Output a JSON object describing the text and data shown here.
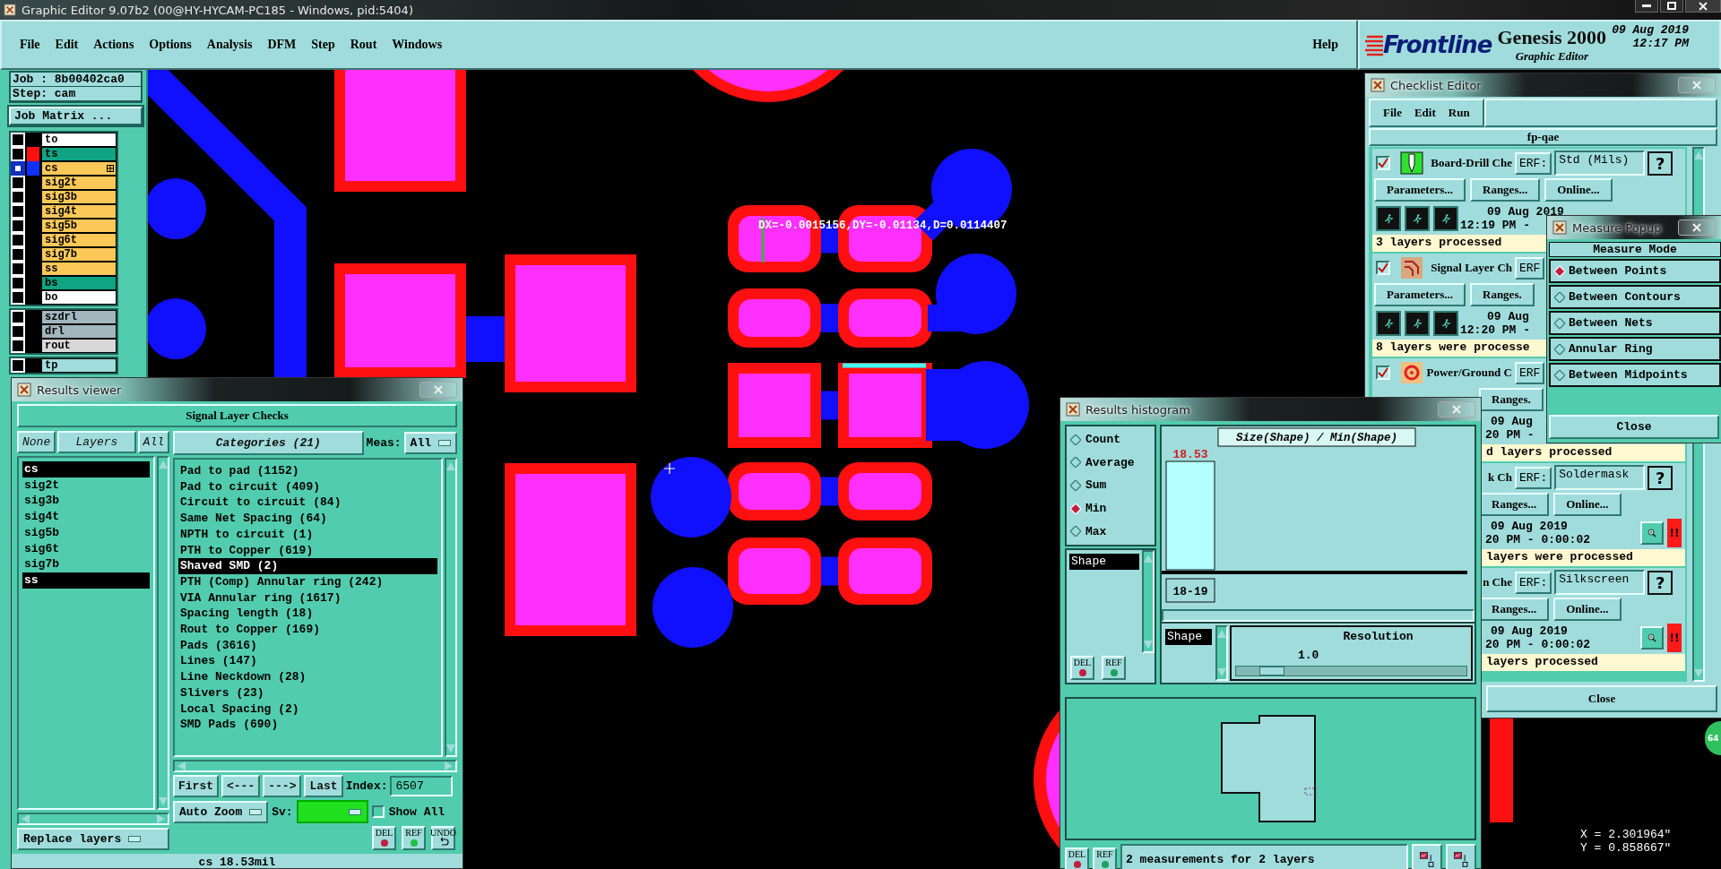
{
  "window": {
    "title": "Graphic Editor 9.07b2 (00@HY-HYCAM-PC185 - Windows, pid:5404)"
  },
  "menu": {
    "items": [
      "File",
      "Edit",
      "Actions",
      "Options",
      "Analysis",
      "DFM",
      "Step",
      "Rout",
      "Windows"
    ],
    "help": "Help"
  },
  "brand": {
    "logo": "Frontline",
    "product": "Genesis 2000",
    "subtitle": "Graphic Editor",
    "date": "09 Aug 2019",
    "time": "12:17 PM"
  },
  "job_panel": {
    "job": "Job : 8b00402ca0",
    "step": "Step: cam",
    "matrix_button": "Job Matrix ..."
  },
  "layer_groups": [
    {
      "layers": [
        {
          "name": "to",
          "kind": "silk",
          "selected": false
        },
        {
          "name": "ts",
          "kind": "mask",
          "color": "#ff1010",
          "selected": false
        },
        {
          "name": "cs",
          "kind": "signal",
          "color": "#1030ff",
          "selected": true
        },
        {
          "name": "sig2t",
          "kind": "signal",
          "selected": false
        },
        {
          "name": "sig3b",
          "kind": "signal",
          "selected": false
        },
        {
          "name": "sig4t",
          "kind": "signal",
          "selected": false
        },
        {
          "name": "sig5b",
          "kind": "signal",
          "selected": false
        },
        {
          "name": "sig6t",
          "kind": "signal",
          "selected": false
        },
        {
          "name": "sig7b",
          "kind": "signal",
          "selected": false
        },
        {
          "name": "ss",
          "kind": "signal",
          "selected": false
        },
        {
          "name": "bs",
          "kind": "mask",
          "selected": false
        },
        {
          "name": "bo",
          "kind": "silk",
          "selected": false
        }
      ]
    },
    {
      "layers": [
        {
          "name": "szdrl",
          "kind": "drill",
          "selected": false
        },
        {
          "name": "drl",
          "kind": "drill",
          "selected": false
        },
        {
          "name": "rout",
          "kind": "rout",
          "selected": false
        }
      ]
    },
    {
      "layers": [
        {
          "name": "tp",
          "kind": "paste",
          "selected": false
        }
      ]
    }
  ],
  "canvas": {
    "measurement": "DX=-0.0015156,DY=-0.01134,D=0.0114407",
    "x_readout": "X = 2.301964\"",
    "y_readout": "Y = 0.858667\"",
    "badge": "64"
  },
  "results_viewer": {
    "title": "Results viewer",
    "heading": "Signal Layer Checks",
    "layer_buttons": [
      "None",
      "Layers",
      "All"
    ],
    "layers": [
      {
        "name": "cs",
        "selected": true
      },
      {
        "name": "sig2t",
        "selected": false
      },
      {
        "name": "sig3b",
        "selected": false
      },
      {
        "name": "sig4t",
        "selected": false
      },
      {
        "name": "sig5b",
        "selected": false
      },
      {
        "name": "sig6t",
        "selected": false
      },
      {
        "name": "sig7b",
        "selected": false
      },
      {
        "name": "ss",
        "selected": true
      }
    ],
    "categories_button": "Categories (21)",
    "meas_label": "Meas:",
    "meas_value": "All",
    "categories": [
      {
        "label": "Pad to pad (1152)",
        "selected": false
      },
      {
        "label": "Pad to circuit (409)",
        "selected": false
      },
      {
        "label": "Circuit to circuit (84)",
        "selected": false
      },
      {
        "label": "Same Net Spacing (64)",
        "selected": false
      },
      {
        "label": "NPTH to circuit (1)",
        "selected": false
      },
      {
        "label": "PTH to Copper (619)",
        "selected": false
      },
      {
        "label": "Shaved SMD (2)",
        "selected": true
      },
      {
        "label": "PTH (Comp) Annular ring (242)",
        "selected": false
      },
      {
        "label": "VIA Annular ring (1617)",
        "selected": false
      },
      {
        "label": "Spacing length (18)",
        "selected": false
      },
      {
        "label": "Rout to Copper (169)",
        "selected": false
      },
      {
        "label": "Pads (3616)",
        "selected": false
      },
      {
        "label": "Lines (147)",
        "selected": false
      },
      {
        "label": "Line Neckdown (28)",
        "selected": false
      },
      {
        "label": "Slivers (23)",
        "selected": false
      },
      {
        "label": "Local Spacing (2)",
        "selected": false
      },
      {
        "label": "SMD Pads (690)",
        "selected": false
      }
    ],
    "nav_buttons": [
      "First",
      "<---",
      "--->",
      "Last"
    ],
    "index_label": "Index:",
    "index_value": "6507",
    "zoom_mode": "Auto Zoom",
    "sv_label": "Sv:",
    "show_all": {
      "label": "Show All",
      "checked": false
    },
    "replace_mode": "Replace layers",
    "tool_buttons": [
      {
        "label": "DEL",
        "kind": "dot",
        "color": "#c02040"
      },
      {
        "label": "REF",
        "kind": "dot",
        "color": "#20c040"
      },
      {
        "label": "UNDO",
        "kind": "undo"
      }
    ],
    "status": "cs 18.53mil"
  },
  "checklist_editor": {
    "title": "Checklist Editor",
    "menu": [
      "File",
      "Edit",
      "Run"
    ],
    "name": "fp-qae",
    "checks": [
      {
        "checked": true,
        "name": "Board-Drill Che",
        "erf": "ERF:",
        "erf_value": "Std (Mils)",
        "help": "?",
        "buttons": [
          "Parameters...",
          "Ranges...",
          "Online..."
        ],
        "covered": false,
        "date": "09 Aug 2019",
        "time": "12:19 PM -",
        "status": "3 layers processed"
      },
      {
        "checked": true,
        "name": "Signal Layer Ch",
        "erf": "ERF",
        "buttons": [
          "Parameters...",
          "Ranges."
        ],
        "covered": false,
        "date": "09 Aug",
        "time": "12:20 PM -",
        "status": "8 layers were processe"
      },
      {
        "checked": true,
        "name": "Power/Ground C",
        "erf": "ERF",
        "buttons": [
          "Ranges."
        ],
        "covered": true,
        "date": "09 Aug",
        "time": "20 PM -",
        "status": "d layers processed"
      },
      {
        "name": "k Ch",
        "erf": "ERF:",
        "erf_value": "Soldermask",
        "help": "?",
        "buttons": [
          "Ranges...",
          "Online..."
        ],
        "covered": true,
        "date": "09 Aug 2019",
        "time": "20 PM - 0:00:02",
        "alert": "!!",
        "status": "layers were processed"
      },
      {
        "name": "n Che",
        "erf": "ERF:",
        "erf_value": "Silkscreen",
        "help": "?",
        "buttons": [
          "Ranges...",
          "Online..."
        ],
        "covered": true,
        "date": "09 Aug 2019",
        "time": "20 PM - 0:00:02",
        "alert": "!!",
        "status": "layers processed"
      }
    ],
    "close": "Close"
  },
  "measure_popup": {
    "title": "Measure Popup",
    "heading": "Measure Mode",
    "modes": [
      {
        "label": "Between Points",
        "selected": true
      },
      {
        "label": "Between Contours",
        "selected": false
      },
      {
        "label": "Between Nets",
        "selected": false
      },
      {
        "label": "Annular Ring",
        "selected": false
      },
      {
        "label": "Between Midpoints",
        "selected": false
      }
    ],
    "close": "Close"
  },
  "histogram": {
    "title": "Results histogram",
    "modes": [
      {
        "label": "Count",
        "selected": false
      },
      {
        "label": "Average",
        "selected": false
      },
      {
        "label": "Sum",
        "selected": false
      },
      {
        "label": "Min",
        "selected": true
      },
      {
        "label": "Max",
        "selected": false
      }
    ],
    "list": [
      {
        "label": "Shape",
        "selected": true
      }
    ],
    "buttons": [
      "DEL",
      "REF"
    ],
    "chart": {
      "title": "Size(Shape) / Min(Shape)",
      "bars": [
        {
          "value_label": "18.53",
          "bin_label": "18-19"
        }
      ]
    },
    "sub_list": [
      {
        "label": "Shape",
        "selected": true
      }
    ],
    "resolution_label": "Resolution",
    "resolution_value": "1.0",
    "resolution": {
      "level": 0.1
    },
    "footer_buttons": [
      "DEL",
      "REF"
    ],
    "status": "2 measurements for 2 layers"
  }
}
